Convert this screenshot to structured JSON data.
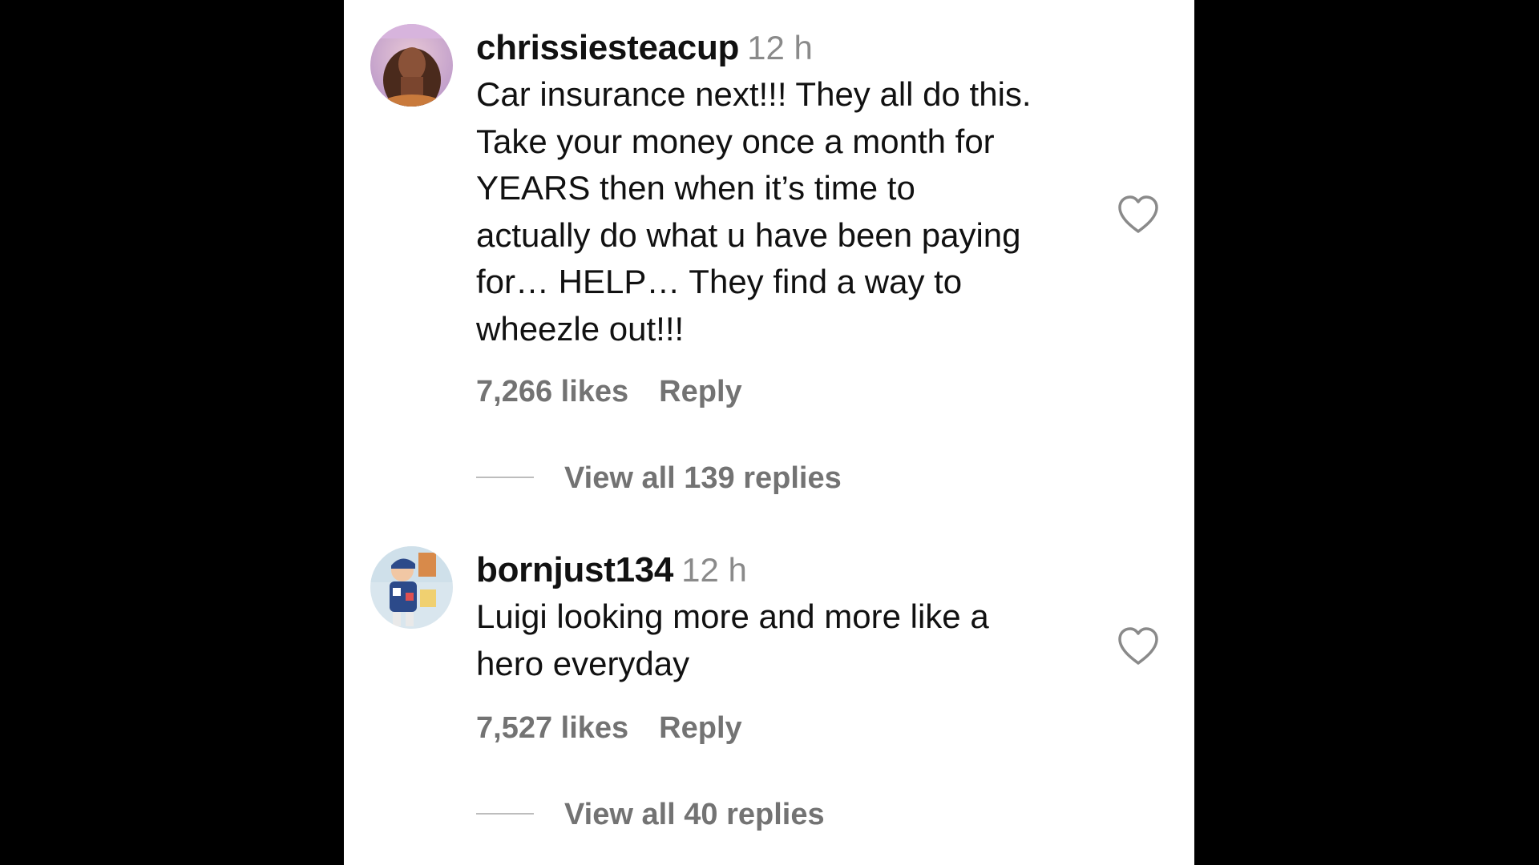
{
  "comments": [
    {
      "username": "chrissiesteacup",
      "time": "12 h",
      "lines": [
        "Car insurance next!!! They all do this.",
        "Take your money once a month for",
        "YEARS then when it’s time to",
        "actually do what u have been paying",
        "for… HELP… They find a way to",
        "wheezle out!!!"
      ],
      "likes": "7,266 likes",
      "reply_label": "Reply",
      "view_replies": "View all 139 replies",
      "avatar_icon": "profile-photo",
      "like_icon": "heart-outline-icon"
    },
    {
      "username": "bornjust134",
      "time": "12 h",
      "lines": [
        "Luigi looking more and more like a",
        "hero everyday"
      ],
      "likes": "7,527 likes",
      "reply_label": "Reply",
      "view_replies": "View all 40 replies",
      "avatar_icon": "profile-photo",
      "like_icon": "heart-outline-icon"
    }
  ],
  "colors": {
    "background": "#000000",
    "panel": "#ffffff",
    "text_primary": "#111111",
    "text_secondary": "#737373"
  }
}
